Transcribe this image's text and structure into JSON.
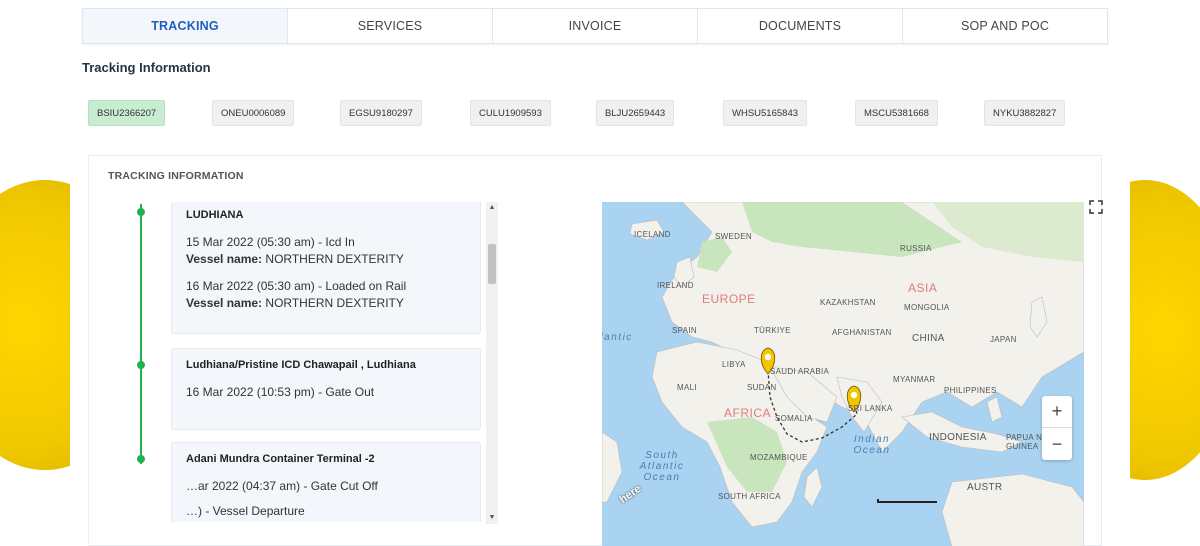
{
  "tabs": [
    {
      "label": "TRACKING",
      "active": true
    },
    {
      "label": "SERVICES",
      "active": false
    },
    {
      "label": "INVOICE",
      "active": false
    },
    {
      "label": "DOCUMENTS",
      "active": false
    },
    {
      "label": "SOP AND POC",
      "active": false
    }
  ],
  "section_title": "Tracking Information",
  "containers": [
    "BSIU2366207",
    "ONEU0006089",
    "EGSU9180297",
    "CULU1909593",
    "BLJU2659443",
    "WHSU5165843",
    "MSCU5381668",
    "NYKU3882827"
  ],
  "active_container": "BSIU2366207",
  "card": {
    "title": "TRACKING INFORMATION",
    "events": [
      {
        "location": "LUDHIANA",
        "entries": [
          {
            "text": "15 Mar 2022 (05:30 am) - Icd In",
            "vessel_label": "Vessel name:",
            "vessel": "NORTHERN DEXTERITY"
          },
          {
            "text": "16 Mar 2022 (05:30 am) - Loaded on Rail",
            "vessel_label": "Vessel name:",
            "vessel": "NORTHERN DEXTERITY"
          }
        ]
      },
      {
        "location": "Ludhiana/Pristine ICD Chawapail , Ludhiana",
        "entries": [
          {
            "text": "16 Mar 2022 (10:53 pm) - Gate Out"
          }
        ]
      },
      {
        "location": "Adani Mundra Container Terminal -2",
        "entries": [
          {
            "text": "…ar 2022 (04:37 am) - Gate Cut Off"
          },
          {
            "text": "…) - Vessel Departure"
          }
        ]
      }
    ]
  },
  "map": {
    "labels": {
      "iceland": "ICELAND",
      "sweden": "SWEDEN",
      "russia": "RUSSIA",
      "ireland": "IRELAND",
      "europe": "EUROPE",
      "kazakhstan": "KAZAKHSTAN",
      "asia": "ASIA",
      "mongolia": "MONGOLIA",
      "spain": "SPAIN",
      "turkiye": "TÜRKIYE",
      "afghanistan": "AFGHANISTAN",
      "china": "CHINA",
      "japan": "JAPAN",
      "libya": "LIBYA",
      "saudi": "SAUDI ARABIA",
      "myanmar": "MYANMAR",
      "philippines": "PHILIPPINES",
      "mali": "MALI",
      "sudan": "SUDAN",
      "africa": "AFRICA",
      "somalia": "SOMALIA",
      "srilanka": "SRI LANKA",
      "indonesia": "INDONESIA",
      "papua": "PAPUA NEW GUINEA",
      "mozambique": "MOZAMBIQUE",
      "southafrica": "SOUTH AFRICA",
      "australia": "AUSTR",
      "indian_ocean": "Indian Ocean",
      "south_atlantic": "South Atlantic Ocean",
      "atlantic": "Atlantic",
      "here_logo": "here"
    },
    "zoom_in": "+",
    "zoom_out": "−",
    "colors": {
      "water": "#a9d3f0",
      "land": "#f2f1ec",
      "forest": "#c9e5bd",
      "route": "#333333",
      "pin": "#f4c400"
    }
  }
}
